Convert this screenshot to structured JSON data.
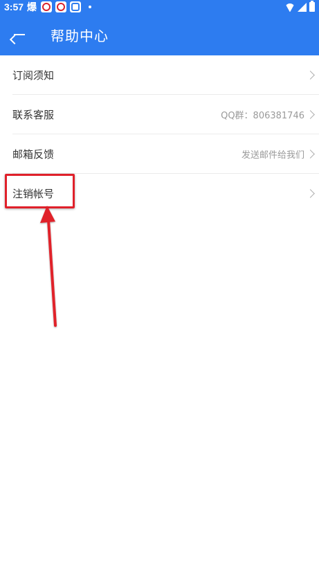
{
  "status_bar": {
    "time": "3:57",
    "extra_char": "爆"
  },
  "app_bar": {
    "title": "帮助中心"
  },
  "list": {
    "items": [
      {
        "label": "订阅须知",
        "value": ""
      },
      {
        "label": "联系客服",
        "value": "QQ群：806381746"
      },
      {
        "label": "邮箱反馈",
        "value": "发送邮件给我们"
      },
      {
        "label": "注销帐号",
        "value": ""
      }
    ]
  },
  "colors": {
    "primary": "#2d7cf0",
    "annotation": "#e0202a"
  },
  "icons": {
    "back": "back-arrow-icon",
    "row_chevron": "chevron-right-icon"
  }
}
